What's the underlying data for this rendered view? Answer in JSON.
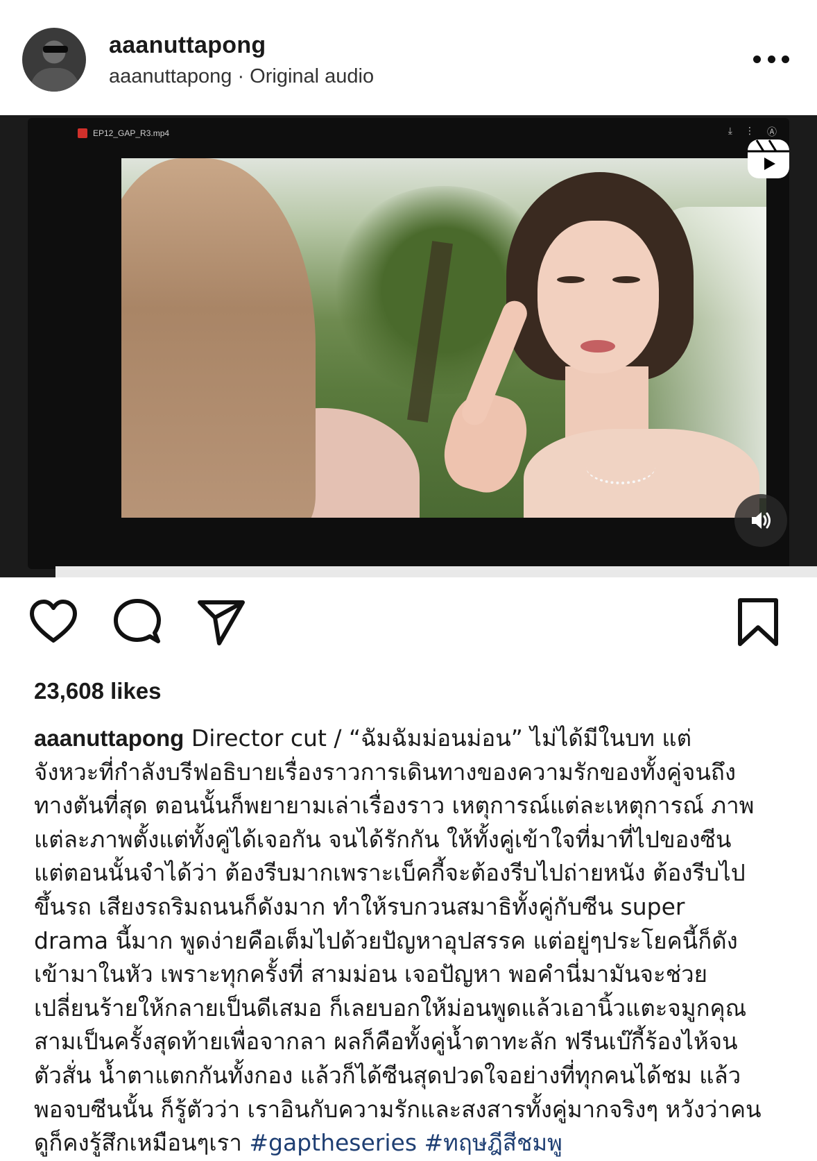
{
  "header": {
    "username": "aaanuttapong",
    "subline": "aaanuttapong · Original audio"
  },
  "media": {
    "filename": "EP12_GAP_R3.mp4",
    "reels_icon": "reels-icon",
    "sound_icon": "speaker-icon"
  },
  "actions": {
    "icons": [
      "heart-icon",
      "comment-icon",
      "share-icon",
      "bookmark-icon"
    ]
  },
  "likes": "23,608 likes",
  "caption": {
    "username": "aaanuttapong",
    "lines": [
      " Director cut / “ฉัมฉัมม่อนม่อน” ไม่ได้มีในบท แต่",
      "จังหวะที่กำลังบรีฟอธิบายเรื่องราวการเดินทางของความรักของทั้งคู่จนถึง",
      "ทางตันที่สุด ตอนนั้นก็พยายามเล่าเรื่องราว เหตุการณ์แต่ละเหตุการณ์ ภาพ",
      "แต่ละภาพตั้งแต่ทั้งคู่ได้เจอกัน จนได้รักกัน ให้ทั้งคู่เข้าใจที่มาที่ไปของซีน",
      "แต่ตอนนั้นจำได้ว่า ต้องรีบมากเพราะเบ็คกี้จะต้องรีบไปถ่ายหนัง ต้องรีบไป",
      "ขึ้นรถ เสียงรถริมถนนก็ดังมาก ทำให้รบกวนสมาธิทั้งคู่กับซีน super",
      "drama นี้มาก พูดง่ายคือเต็มไปด้วยปัญหาอุปสรรค แต่อยู่ๆประโยคนี้ก็ดัง",
      "เข้ามาในหัว เพราะทุกครั้งที่ สามม่อน เจอปัญหา พอคำนี่มามันจะช่วย",
      "เปลี่ยนร้ายให้กลายเป็นดีเสมอ ก็เลยบอกให้ม่อนพูดแล้วเอานิ้วแตะจมูกคุณ",
      "สามเป็นครั้งสุดท้ายเพื่อจากลา ผลก็คือทั้งคู่น้ำตาทะลัก ฟรีนเบ๊กี้ร้องไห้จน",
      "ตัวสั่น น้ำตาแตกกันทั้งกอง แล้วก็ได้ซีนสุดปวดใจอย่างที่ทุกคนได้ชม แล้ว",
      "พอจบซีนนั้น ก็รู้ตัวว่า เราอินกับความรักและสงสารทั้งคู่มากจริงๆ หวังว่าคน"
    ],
    "last_line_text": "ดูก็คงรู้สึกเหมือนๆเรา ",
    "hashtags": [
      "#gaptheseries",
      "#ทฤษฎีสีชมพู"
    ]
  },
  "colors": {
    "hashtag": "#1f3f73",
    "text": "#1a1a1a"
  }
}
